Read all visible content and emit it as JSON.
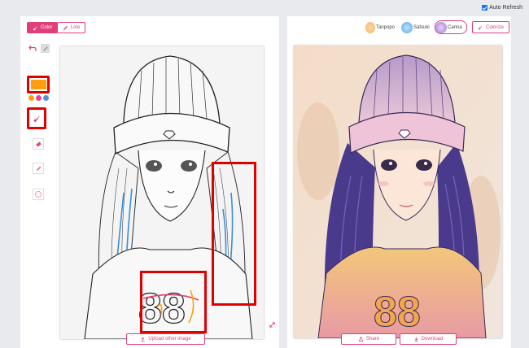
{
  "top": {
    "auto_refresh_label": "Auto Refresh",
    "auto_refresh_checked": true
  },
  "left": {
    "tabs": [
      {
        "label": "Color"
      },
      {
        "label": "Line"
      }
    ],
    "color_swatch": "#ff9e0e",
    "palette": [
      "#ff9e0e",
      "#e04a8a",
      "#5a8fd0"
    ],
    "upload_label": "Upload other image"
  },
  "right": {
    "styles": [
      {
        "label": "Tanpopo"
      },
      {
        "label": "Satsuki"
      },
      {
        "label": "Canna"
      }
    ],
    "colorize_label": "Colorize",
    "share_label": "Share",
    "download_label": "Download"
  },
  "colors": {
    "accent": "#e0407a",
    "highlight": "#e00000"
  }
}
